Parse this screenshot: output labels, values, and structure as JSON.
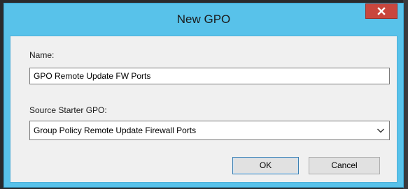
{
  "window": {
    "title": "New GPO",
    "close_label": "x"
  },
  "form": {
    "name_label": "Name:",
    "name_value": "GPO Remote Update FW Ports",
    "source_label": "Source Starter GPO:",
    "source_selected": "Group Policy Remote Update Firewall Ports"
  },
  "buttons": {
    "ok_label": "OK",
    "cancel_label": "Cancel"
  },
  "colors": {
    "titlebar": "#58c2ea",
    "close_button": "#c9463d",
    "client_background": "#f0f0f0"
  }
}
